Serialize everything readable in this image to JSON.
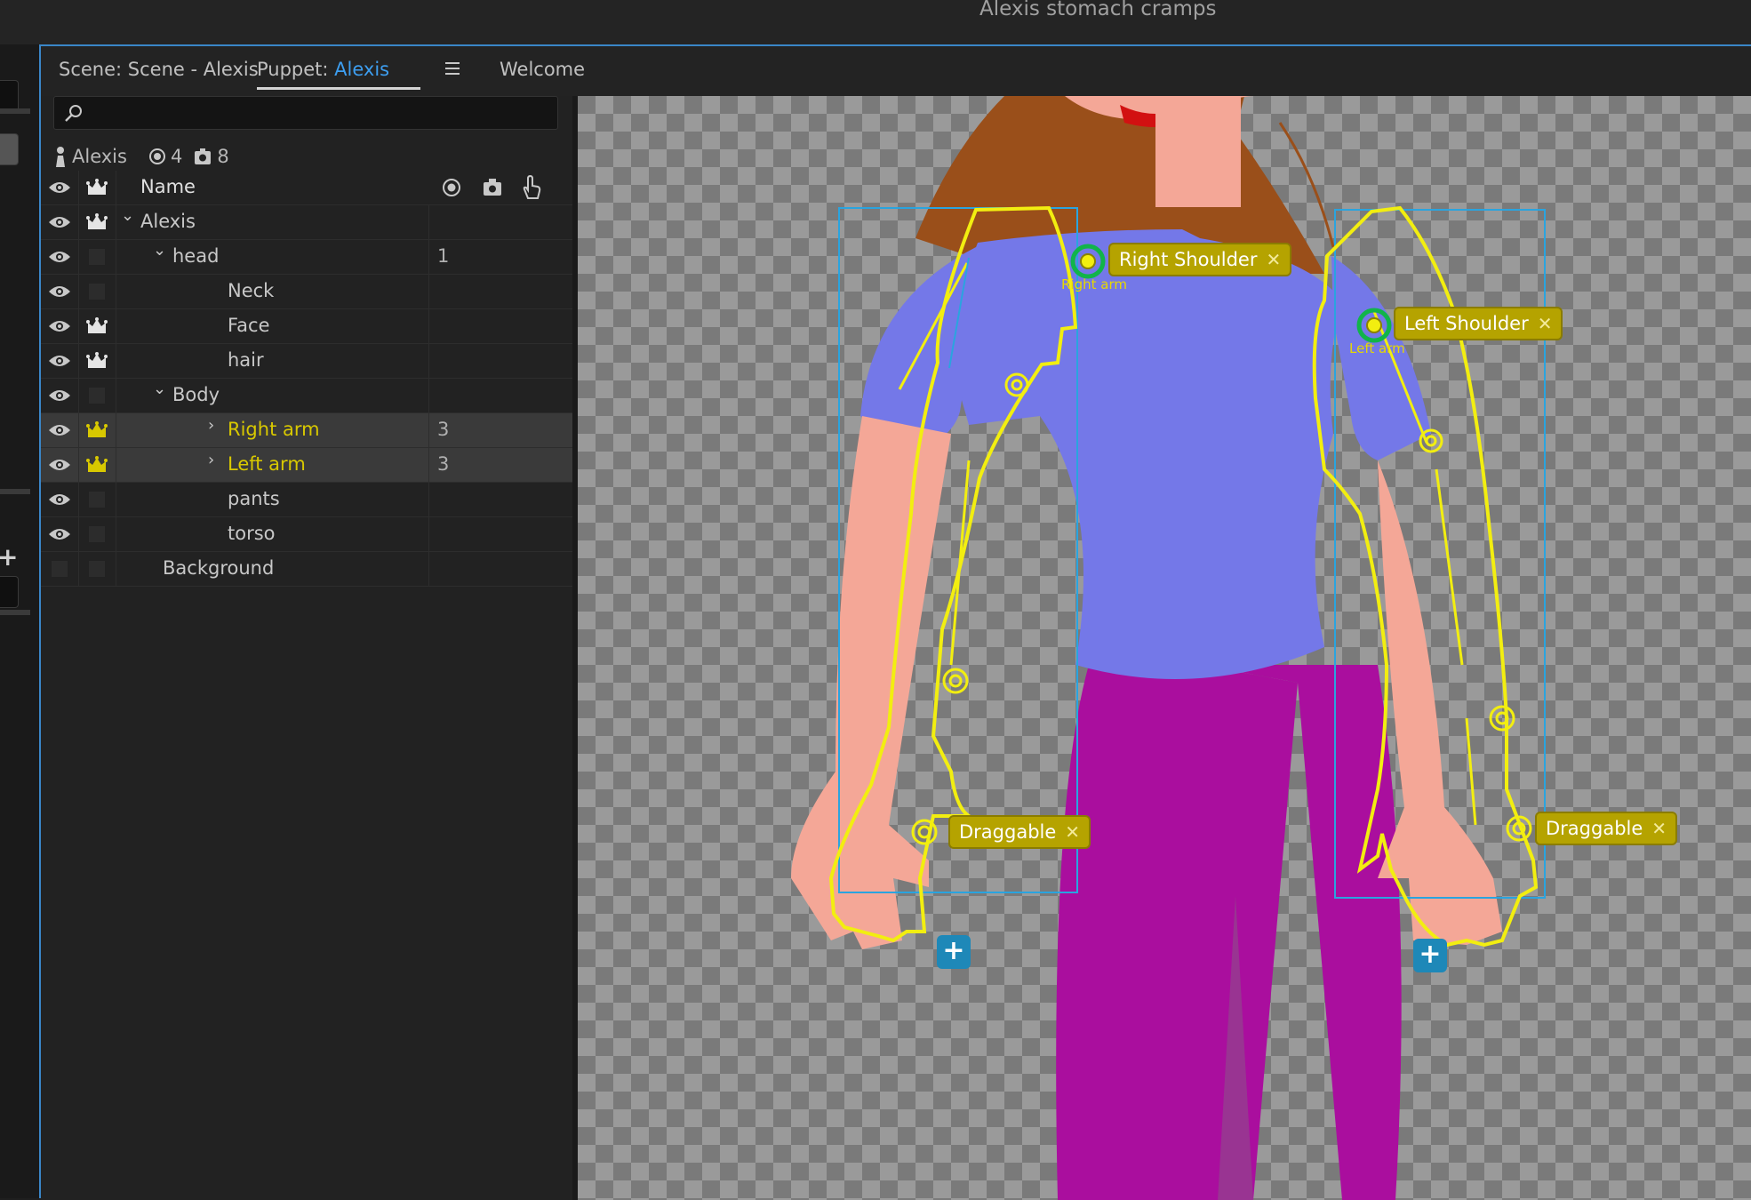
{
  "app": {
    "title": "Alexis stomach cramps"
  },
  "tabs": {
    "scene": "Scene: Scene - Alexis",
    "puppet_prefix": "Puppet: ",
    "puppet_name": "Alexis",
    "welcome": "Welcome"
  },
  "search": {
    "placeholder": ""
  },
  "puppet_info": {
    "name": "Alexis",
    "handles": "4",
    "triggers": "8"
  },
  "tree": {
    "header": {
      "name": "Name"
    },
    "rows": [
      {
        "label": "Alexis",
        "num": ""
      },
      {
        "label": "head",
        "num": "1"
      },
      {
        "label": "Neck",
        "num": ""
      },
      {
        "label": "Face",
        "num": ""
      },
      {
        "label": "hair",
        "num": ""
      },
      {
        "label": "Body",
        "num": ""
      },
      {
        "label": "Right arm",
        "num": "3"
      },
      {
        "label": "Left arm",
        "num": "3"
      },
      {
        "label": "pants",
        "num": ""
      },
      {
        "label": "torso",
        "num": ""
      },
      {
        "label": "Background",
        "num": ""
      }
    ]
  },
  "canvas": {
    "tags": {
      "right_shoulder": "Right Shoulder",
      "left_shoulder": "Left Shoulder",
      "draggable_left": "Draggable",
      "draggable_right": "Draggable"
    },
    "handle_labels": {
      "right_arm": "Right arm",
      "left_arm": "Left arm"
    },
    "add_button": "+"
  },
  "colors": {
    "accent": "#3d9ef0",
    "selection_yellow": "#d8c800",
    "shirt": "#7478e8",
    "pants": "#aa0e9e",
    "skin": "#f4a797",
    "hair": "#9a4f1a"
  }
}
